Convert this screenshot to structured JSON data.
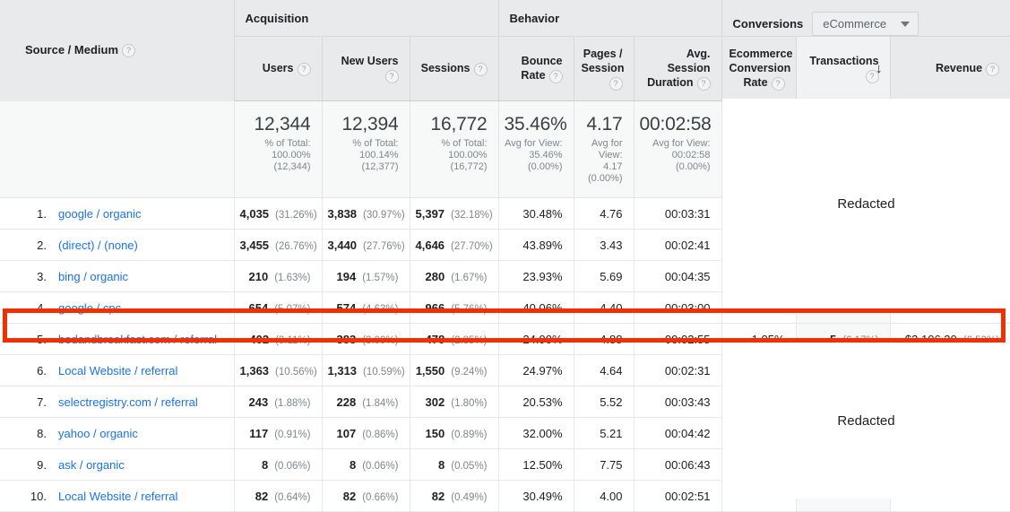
{
  "header": {
    "source_medium_label": "Source / Medium",
    "groups": {
      "acquisition": "Acquisition",
      "behavior": "Behavior",
      "conversions": "Conversions"
    },
    "conversion_select": {
      "value": "eCommerce",
      "caret_icon": "chevron-down-icon"
    },
    "help_icon": "?",
    "sort_arrow_icon": "↓",
    "metrics": {
      "users": "Users",
      "new_users": "New Users",
      "sessions": "Sessions",
      "bounce_rate": "Bounce Rate",
      "pages_session": "Pages / Session",
      "avg_session_duration": "Avg. Session Duration",
      "ecommerce_conversion_rate": "Ecommerce Conversion Rate",
      "transactions": "Transactions",
      "revenue": "Revenue"
    }
  },
  "summary": {
    "users": {
      "value": "12,344",
      "sub": "% of Total: 100.00% (12,344)"
    },
    "new_users": {
      "value": "12,394",
      "sub": "% of Total: 100.14% (12,377)"
    },
    "sessions": {
      "value": "16,772",
      "sub": "% of Total: 100.00% (16,772)"
    },
    "bounce_rate": {
      "value": "35.46%",
      "sub": "Avg for View: 35.46% (0.00%)"
    },
    "pages_session": {
      "value": "4.17",
      "sub": "Avg for View: 4.17 (0.00%)"
    },
    "avg_session_duration": {
      "value": "00:02:58",
      "sub": "Avg for View: 00:02:58 (0.00%)"
    }
  },
  "redacted_label": "Redacted",
  "rows": [
    {
      "rank": "1.",
      "source": "google / organic",
      "users": "4,035",
      "users_pct": "(31.26%)",
      "new_users": "3,838",
      "new_users_pct": "(30.97%)",
      "sessions": "5,397",
      "sessions_pct": "(32.18%)",
      "bounce_rate": "30.48%",
      "pages_session": "4.76",
      "avg_session_duration": "00:03:31",
      "ecommerce_conversion_rate": "",
      "transactions": "",
      "transactions_pct": "",
      "revenue": "",
      "revenue_pct": "",
      "highlighted": false
    },
    {
      "rank": "2.",
      "source": "(direct) / (none)",
      "users": "3,455",
      "users_pct": "(26.76%)",
      "new_users": "3,440",
      "new_users_pct": "(27.76%)",
      "sessions": "4,646",
      "sessions_pct": "(27.70%)",
      "bounce_rate": "43.89%",
      "pages_session": "3.43",
      "avg_session_duration": "00:02:41",
      "ecommerce_conversion_rate": "",
      "transactions": "",
      "transactions_pct": "",
      "revenue": "",
      "revenue_pct": "",
      "highlighted": false
    },
    {
      "rank": "3.",
      "source": "bing / organic",
      "users": "210",
      "users_pct": "(1.63%)",
      "new_users": "194",
      "new_users_pct": "(1.57%)",
      "sessions": "280",
      "sessions_pct": "(1.67%)",
      "bounce_rate": "23.93%",
      "pages_session": "5.69",
      "avg_session_duration": "00:04:35",
      "ecommerce_conversion_rate": "",
      "transactions": "",
      "transactions_pct": "",
      "revenue": "",
      "revenue_pct": "",
      "highlighted": false
    },
    {
      "rank": "4.",
      "source": "google / cpc",
      "users": "654",
      "users_pct": "(5.07%)",
      "new_users": "574",
      "new_users_pct": "(4.63%)",
      "sessions": "966",
      "sessions_pct": "(5.76%)",
      "bounce_rate": "40.06%",
      "pages_session": "4.40",
      "avg_session_duration": "00:03:00",
      "ecommerce_conversion_rate": "",
      "transactions": "",
      "transactions_pct": "",
      "revenue": "",
      "revenue_pct": "",
      "highlighted": false
    },
    {
      "rank": "5.",
      "source": "bedandbreakfast.com / referral",
      "users": "402",
      "users_pct": "(3.11%)",
      "new_users": "383",
      "new_users_pct": "(3.09%)",
      "sessions": "478",
      "sessions_pct": "(2.85%)",
      "bounce_rate": "24.90%",
      "pages_session": "4.88",
      "avg_session_duration": "00:02:55",
      "ecommerce_conversion_rate": "1.05%",
      "transactions": "5",
      "transactions_pct": "(6.17%)",
      "revenue": "$3,106.30",
      "revenue_pct": "(6.53%)",
      "highlighted": true
    },
    {
      "rank": "6.",
      "source": "Local Website / referral",
      "users": "1,363",
      "users_pct": "(10.56%)",
      "new_users": "1,313",
      "new_users_pct": "(10.59%)",
      "sessions": "1,550",
      "sessions_pct": "(9.24%)",
      "bounce_rate": "24.97%",
      "pages_session": "4.64",
      "avg_session_duration": "00:02:31",
      "ecommerce_conversion_rate": "",
      "transactions": "",
      "transactions_pct": "",
      "revenue": "",
      "revenue_pct": "",
      "highlighted": false
    },
    {
      "rank": "7.",
      "source": "selectregistry.com / referral",
      "users": "243",
      "users_pct": "(1.88%)",
      "new_users": "228",
      "new_users_pct": "(1.84%)",
      "sessions": "302",
      "sessions_pct": "(1.80%)",
      "bounce_rate": "20.53%",
      "pages_session": "5.52",
      "avg_session_duration": "00:03:43",
      "ecommerce_conversion_rate": "",
      "transactions": "",
      "transactions_pct": "",
      "revenue": "",
      "revenue_pct": "",
      "highlighted": false
    },
    {
      "rank": "8.",
      "source": "yahoo / organic",
      "users": "117",
      "users_pct": "(0.91%)",
      "new_users": "107",
      "new_users_pct": "(0.86%)",
      "sessions": "150",
      "sessions_pct": "(0.89%)",
      "bounce_rate": "32.00%",
      "pages_session": "5.21",
      "avg_session_duration": "00:04:42",
      "ecommerce_conversion_rate": "",
      "transactions": "",
      "transactions_pct": "",
      "revenue": "",
      "revenue_pct": "",
      "highlighted": false
    },
    {
      "rank": "9.",
      "source": "ask / organic",
      "users": "8",
      "users_pct": "(0.06%)",
      "new_users": "8",
      "new_users_pct": "(0.06%)",
      "sessions": "8",
      "sessions_pct": "(0.05%)",
      "bounce_rate": "12.50%",
      "pages_session": "7.75",
      "avg_session_duration": "00:06:43",
      "ecommerce_conversion_rate": "",
      "transactions": "",
      "transactions_pct": "",
      "revenue": "",
      "revenue_pct": "",
      "highlighted": false
    },
    {
      "rank": "10.",
      "source": "Local Website / referral",
      "users": "82",
      "users_pct": "(0.64%)",
      "new_users": "82",
      "new_users_pct": "(0.66%)",
      "sessions": "82",
      "sessions_pct": "(0.49%)",
      "bounce_rate": "30.49%",
      "pages_session": "4.00",
      "avg_session_duration": "00:02:51",
      "ecommerce_conversion_rate": "",
      "transactions": "",
      "transactions_pct": "",
      "revenue": "",
      "revenue_pct": "",
      "highlighted": false
    }
  ],
  "colors": {
    "link": "#1a73e8",
    "highlight": "#f03000",
    "header_bg": "#e8eaeb"
  }
}
